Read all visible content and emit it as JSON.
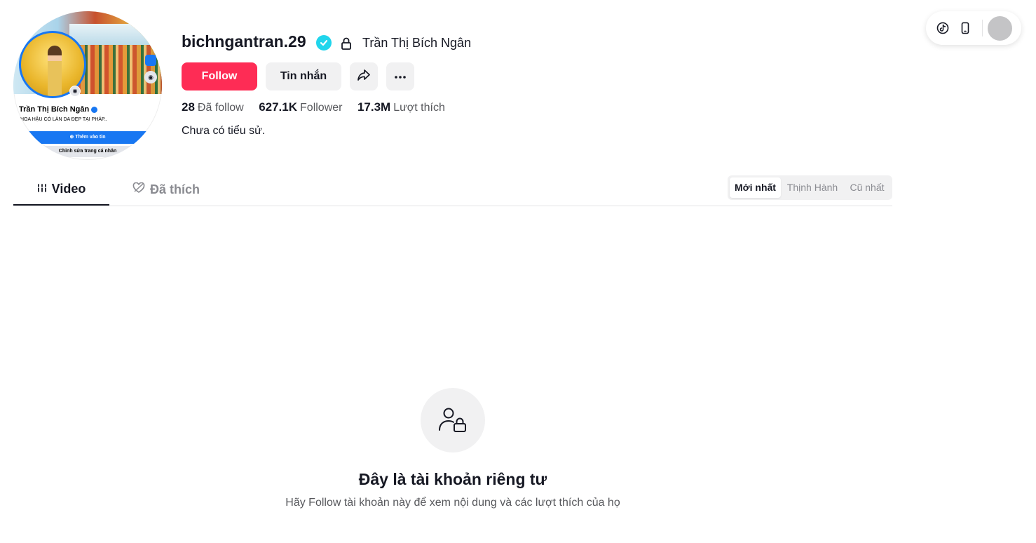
{
  "profile": {
    "username": "bichngantran.29",
    "display_name": "Trần Thị Bích Ngân",
    "verified": true,
    "private": true,
    "bio": "Chưa có tiểu sử.",
    "avatar": {
      "name": "Trần Thị Bích Ngân",
      "subtitle": "HOA HẬU CÓ LÀN DA ĐẸP TẠI PHÁP..",
      "button": "Thêm vào tin",
      "edit": "Chỉnh sửa trang cá nhân"
    }
  },
  "actions": {
    "follow_label": "Follow",
    "message_label": "Tin nhắn",
    "share_icon": "share-icon",
    "more_icon": "more-icon"
  },
  "stats": [
    {
      "value": "28",
      "label": "Đã follow"
    },
    {
      "value": "627.1K",
      "label": "Follower"
    },
    {
      "value": "17.3M",
      "label": "Lượt thích"
    }
  ],
  "tabs": [
    {
      "label": "Video",
      "active": true,
      "icon": "grid-icon"
    },
    {
      "label": "Đã thích",
      "active": false,
      "icon": "liked-icon"
    }
  ],
  "sort": [
    {
      "label": "Mới nhất",
      "active": true
    },
    {
      "label": "Thịnh Hành",
      "active": false
    },
    {
      "label": "Cũ nhất",
      "active": false
    }
  ],
  "private_notice": {
    "title": "Đây là tài khoản riêng tư",
    "description": "Hãy Follow tài khoản này để xem nội dung và các lượt thích của họ"
  },
  "colors": {
    "follow": "#fe2c55",
    "verified": "#20d5ec",
    "text": "#161823",
    "secondary_text": "#57585c",
    "button_bg": "#f1f1f2"
  }
}
